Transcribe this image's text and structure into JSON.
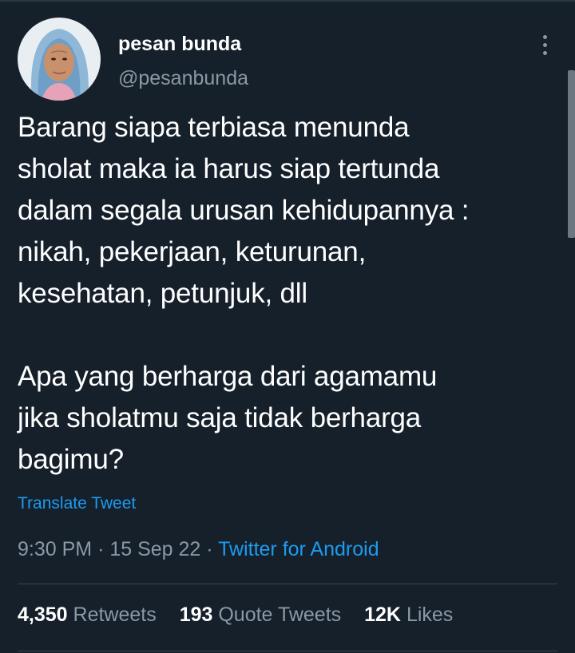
{
  "tweet": {
    "author": {
      "display_name": "pesan bunda",
      "handle": "@pesanbunda"
    },
    "text": "Barang siapa terbiasa menunda\nsholat maka ia harus siap tertunda\ndalam segala urusan kehidupannya :\nnikah, pekerjaan, keturunan,\nkesehatan, petunjuk, dll\n\nApa yang berharga dari agamamu\njika sholatmu saja tidak berharga\nbagimu?",
    "translate_label": "Translate Tweet",
    "time": "9:30 PM",
    "separator": "·",
    "date": "15 Sep 22",
    "source": "Twitter for Android",
    "stats": {
      "retweets": {
        "count": "4,350",
        "label": "Retweets"
      },
      "quote_tweets": {
        "count": "193",
        "label": "Quote Tweets"
      },
      "likes": {
        "count": "12K",
        "label": "Likes"
      }
    }
  },
  "icons": {
    "more": "more-vertical-icon"
  },
  "colors": {
    "background": "#15202b",
    "accent": "#1d9bf0",
    "secondary_text": "#8b98a5",
    "divider": "#38444d"
  }
}
